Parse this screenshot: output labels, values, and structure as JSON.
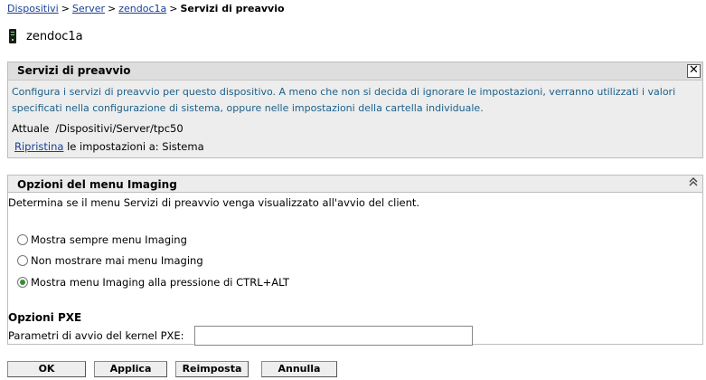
{
  "breadcrumb": {
    "items": [
      "Dispositivi",
      "Server",
      "zendoc1a"
    ],
    "current": "Servizi di preavvio",
    "separator": ">"
  },
  "device": {
    "name": "zendoc1a",
    "icon": "server-icon"
  },
  "preboot_panel": {
    "title": "Servizi di preavvio",
    "close_label": "✕",
    "description_line1": "Configura i servizi di preavvio per questo dispositivo. A meno che non si decida di ignorare le impostazioni, verranno utilizzati i valori",
    "description_line2": "specificati nella configurazione di sistema, oppure nelle impostazioni della cartella individuale.",
    "current_label": "Attuale",
    "current_path": "/Dispositivi/Server/tpc50",
    "reset_link": "Ripristina",
    "reset_text": "le impostazioni a: Sistema"
  },
  "imaging_menu": {
    "title": "Opzioni del menu Imaging",
    "collapse_label": "⌃",
    "description": "Determina se il menu Servizi di preavvio venga visualizzato all'avvio del client.",
    "options": [
      {
        "label": "Mostra sempre menu Imaging",
        "checked": false
      },
      {
        "label": "Non mostrare mai menu Imaging",
        "checked": false
      },
      {
        "label": "Mostra menu Imaging alla pressione di CTRL+ALT",
        "checked": true
      }
    ]
  },
  "pxe": {
    "title": "Opzioni PXE",
    "kernel_label": "Parametri di avvio del kernel PXE:",
    "kernel_value": ""
  },
  "buttons": {
    "ok": "OK",
    "apply": "Applica",
    "reset": "Reimposta",
    "cancel": "Annulla"
  }
}
